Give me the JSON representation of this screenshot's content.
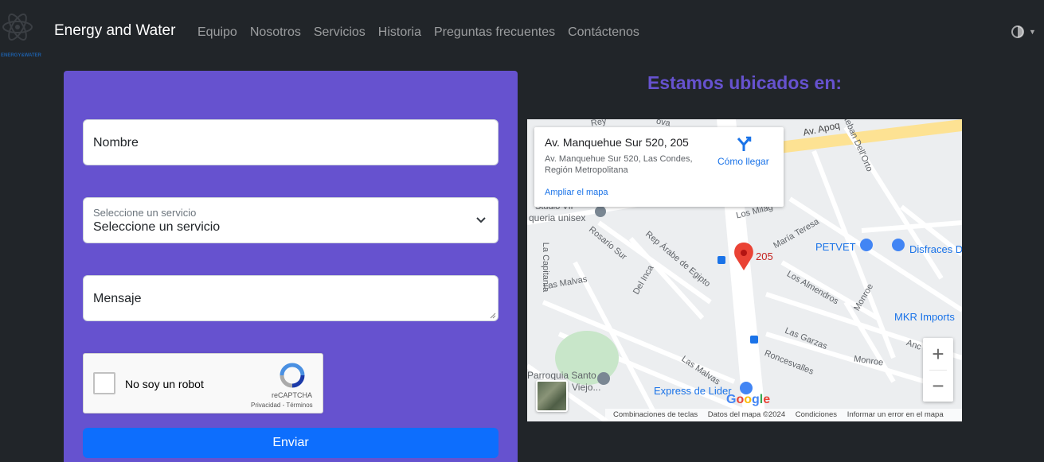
{
  "navbar": {
    "logo_text": "ENERGY&WATER",
    "brand": "Energy and Water",
    "links": [
      "Equipo",
      "Nosotros",
      "Servicios",
      "Historia",
      "Preguntas frecuentes",
      "Contáctenos"
    ],
    "theme_icon": "half-circle-icon"
  },
  "form": {
    "name_placeholder": "Nombre",
    "service_label": "Seleccione un servicio",
    "service_value": "Seleccione un servicio",
    "message_placeholder": "Mensaje",
    "captcha": {
      "label": "No soy un robot",
      "brand": "reCAPTCHA",
      "links": "Privacidad - Términos"
    },
    "submit": "Enviar",
    "card_color": "#6652cf",
    "button_color": "#0d6efd"
  },
  "location": {
    "title": "Estamos ubicados en:",
    "map": {
      "info_title": "Av. Manquehue Sur 520, 205",
      "info_address": "Av. Manquehue Sur 520, Las Condes, Región Metropolitana",
      "directions": "Cómo llegar",
      "enlarge": "Ampliar el mapa",
      "pin_label": "205",
      "streets": [
        "Av. Apoq",
        "Esteban Dell'Orto",
        "Los Milag",
        "María Teresa",
        "Rosario Sur",
        "Rep Árabe de Egipto",
        "Del Inca",
        "La Capitanía",
        "Las Malvas",
        "Los Almendros",
        "Monroe",
        "Las Garzas",
        "Roncesvalles",
        "Las Malvas",
        "Studio VIP",
        "queria unisex",
        "Parroquia Santo",
        "Viejo...",
        "Anc",
        "Rey",
        "ova"
      ],
      "pois": [
        "PETVET",
        "Disfraces D",
        "MKR Imports",
        "Express de Lider"
      ],
      "google": "Google",
      "attribution": [
        "Combinaciones de teclas",
        "Datos del mapa ©2024",
        "Condiciones",
        "Informar un error en el mapa"
      ],
      "zoom_in": "+",
      "zoom_out": "−"
    }
  }
}
